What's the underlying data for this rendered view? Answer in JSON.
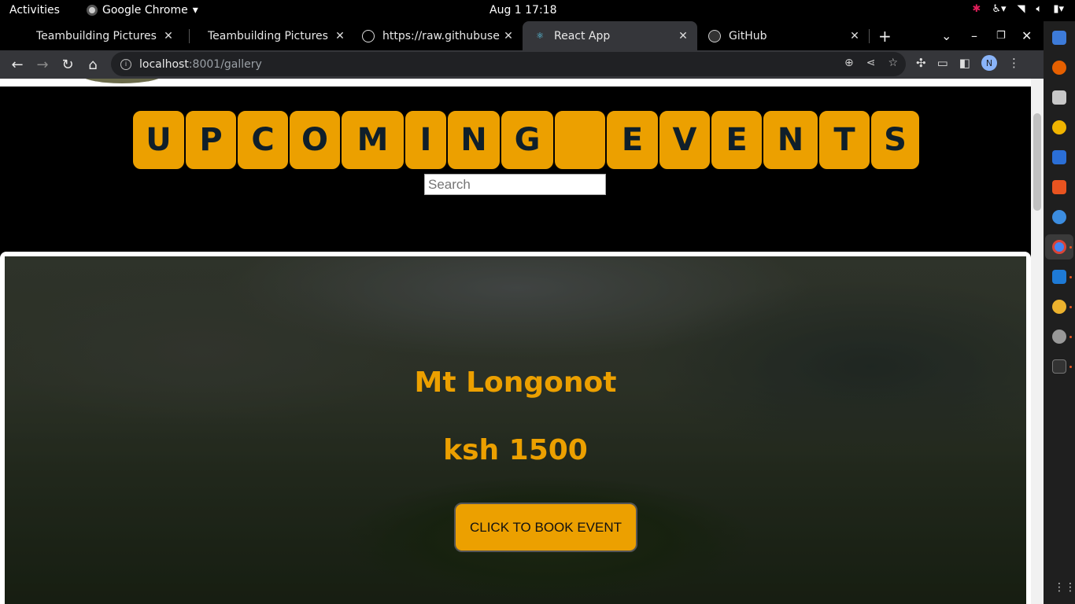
{
  "system_bar": {
    "activities": "Activities",
    "app_name": "Google Chrome",
    "clock": "Aug 1  17:18"
  },
  "tabs": [
    {
      "title": "Teambuilding Pictures",
      "active": false
    },
    {
      "title": "Teambuilding Pictures",
      "active": false
    },
    {
      "title": "https://raw.githubuse",
      "active": false
    },
    {
      "title": "React App",
      "active": true
    },
    {
      "title": "GitHub",
      "active": false
    }
  ],
  "toolbar": {
    "url_host": "localhost",
    "url_path": ":8001/gallery",
    "profile_initial": "N"
  },
  "page": {
    "heading_letters": [
      "U",
      "P",
      "C",
      "O",
      "M",
      "I",
      "N",
      "G",
      " ",
      "E",
      "V",
      "E",
      "N",
      "T",
      "S"
    ],
    "search_placeholder": "Search",
    "event": {
      "name": "Mt Longonot",
      "price": "ksh 1500",
      "book_label": "CLICK TO BOOK EVENT"
    }
  },
  "colors": {
    "accent": "#eca000",
    "letter_text": "#0f1f2a",
    "chrome_frame": "#35363a"
  }
}
